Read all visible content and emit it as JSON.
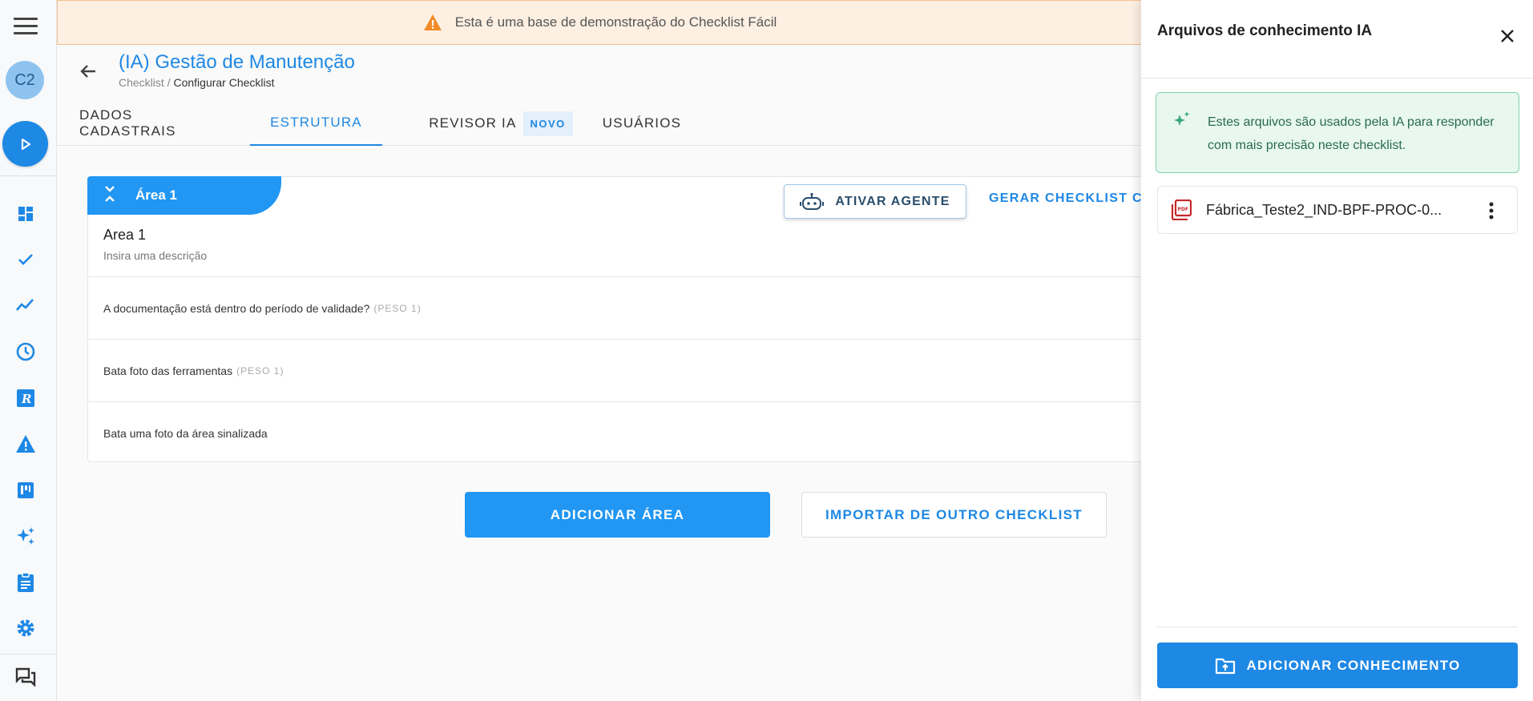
{
  "sidebar": {
    "avatar_initials": "C2",
    "nav_icons": [
      "dashboard-icon",
      "checkmark-icon",
      "trending-icon",
      "clock-icon",
      "r-app-icon",
      "warning-icon",
      "kanban-icon",
      "sparkles-icon",
      "clipboard-icon",
      "gear-icon",
      "chat-icon"
    ]
  },
  "banner": {
    "text": "Esta é uma base de demonstração do Checklist Fácil"
  },
  "header": {
    "title": "(IA) Gestão de Manutenção",
    "breadcrumb_root": "Checklist /",
    "breadcrumb_current": "Configurar Checklist"
  },
  "tabs": [
    {
      "label": "DADOS CADASTRAIS"
    },
    {
      "label": "ESTRUTURA",
      "active": true
    },
    {
      "label": "REVISOR IA",
      "badge": "NOVO"
    },
    {
      "label": "USUÁRIOS"
    }
  ],
  "area": {
    "tab_label": "Área 1",
    "agent_button": "ATIVAR AGENTE",
    "generate_button": "GERAR CHECKLIST CO",
    "name": "Area 1",
    "description": "Insira uma descrição",
    "questions": [
      {
        "text": "A documentação está dentro do período de validade?",
        "peso": "(PESO 1)"
      },
      {
        "text": "Bata foto das ferramentas",
        "peso": "(PESO 1)"
      },
      {
        "text": "Bata uma foto da área sinalizada",
        "peso": ""
      }
    ]
  },
  "actions": {
    "add_area": "ADICIONAR ÁREA",
    "import": "IMPORTAR DE OUTRO CHECKLIST"
  },
  "drawer": {
    "title": "Arquivos de conhecimento IA",
    "info_text": "Estes arquivos são usados pela IA para responder com mais precisão neste checklist.",
    "file_name": "Fábrica_Teste2_IND-BPF-PROC-0...",
    "add_button": "ADICIONAR CONHECIMENTO"
  },
  "colors": {
    "primary": "#2196f3",
    "banner_bg": "#fdf0e3",
    "info_bg": "#e8f7f0",
    "pdf_red": "#c62828"
  }
}
